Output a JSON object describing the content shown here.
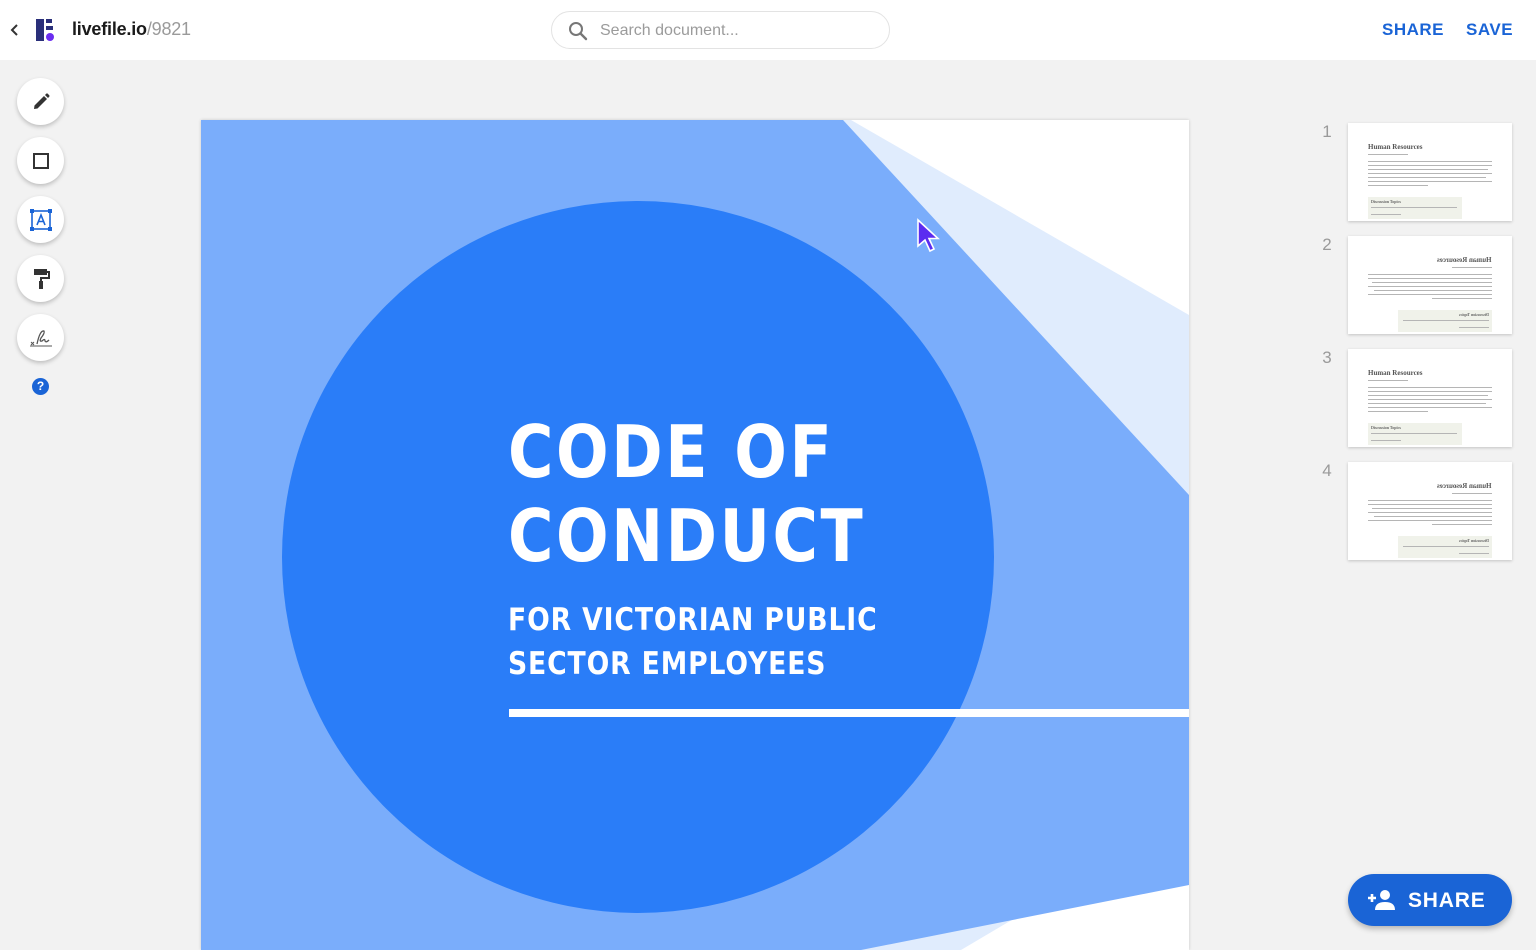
{
  "header": {
    "brand_name": "livefile.io",
    "doc_id": "/9821",
    "search_placeholder": "Search document...",
    "share_label": "SHARE",
    "save_label": "SAVE"
  },
  "toolbar": {
    "tools": [
      {
        "name": "pencil-icon",
        "label": "Draw"
      },
      {
        "name": "rectangle-icon",
        "label": "Shape"
      },
      {
        "name": "text-box-icon",
        "label": "Text"
      },
      {
        "name": "paint-roller-icon",
        "label": "Format"
      },
      {
        "name": "signature-icon",
        "label": "Sign"
      }
    ],
    "help_label": "?"
  },
  "document": {
    "title_line1": "CODE OF",
    "title_line2": "CONDUCT",
    "subtitle_line1": "FOR VICTORIAN PUBLIC",
    "subtitle_line2": "SECTOR EMPLOYEES"
  },
  "thumbnails": [
    {
      "number": "1",
      "heading": "Human Resources",
      "mirrored": false,
      "box_title": "Discussion Topics"
    },
    {
      "number": "2",
      "heading": "Human Resources",
      "mirrored": true,
      "box_title": "Discussion Topics"
    },
    {
      "number": "3",
      "heading": "Human Resources",
      "mirrored": false,
      "box_title": "Discussion Topics"
    },
    {
      "number": "4",
      "heading": "Human Resources",
      "mirrored": true,
      "box_title": "Discussion Topics"
    }
  ],
  "fab": {
    "share_label": "SHARE"
  },
  "colors": {
    "accent": "#1a64d6",
    "cover_light_blue": "#7aadfb",
    "cover_pale_blue": "#e0ecfd",
    "cover_circle": "#2a7df8"
  }
}
